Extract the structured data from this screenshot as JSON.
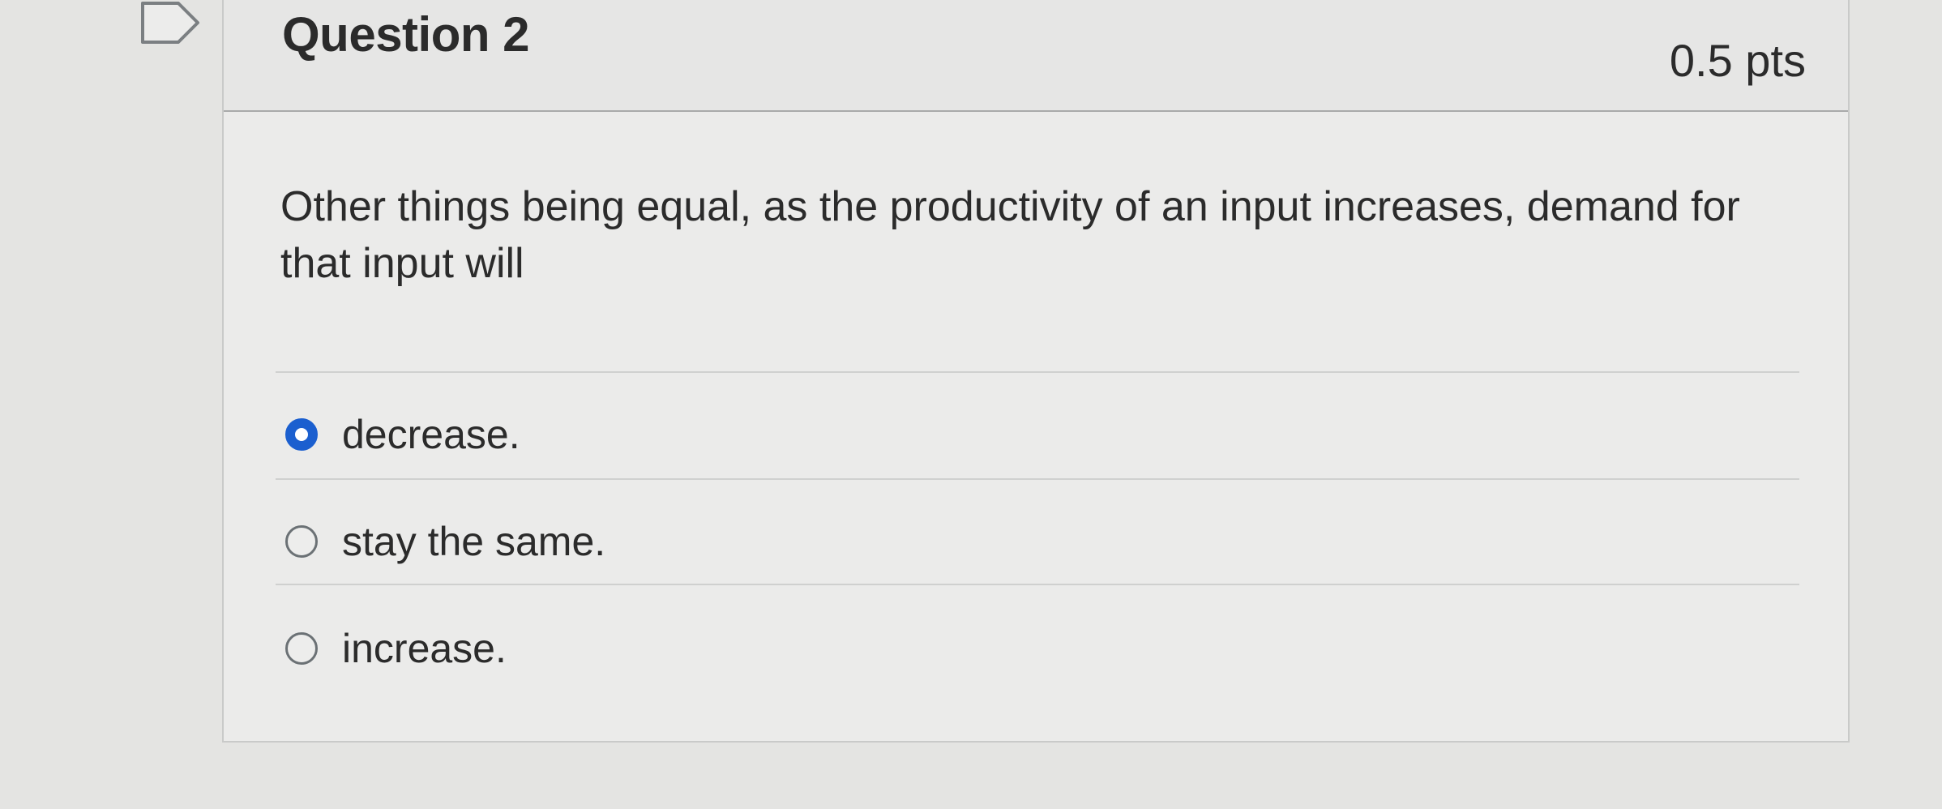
{
  "question": {
    "title": "Question 2",
    "points": "0.5 pts",
    "text": "Other things being equal, as the productivity of an input increases, demand for that input will",
    "flag_icon": "bookmark-flag-icon",
    "answers": [
      {
        "label": "decrease.",
        "selected": true
      },
      {
        "label": "stay the same.",
        "selected": false
      },
      {
        "label": "increase.",
        "selected": false
      }
    ]
  },
  "colors": {
    "selected_radio": "#1b5fcf",
    "text": "#2b2b2b",
    "background": "#e4e4e2"
  }
}
